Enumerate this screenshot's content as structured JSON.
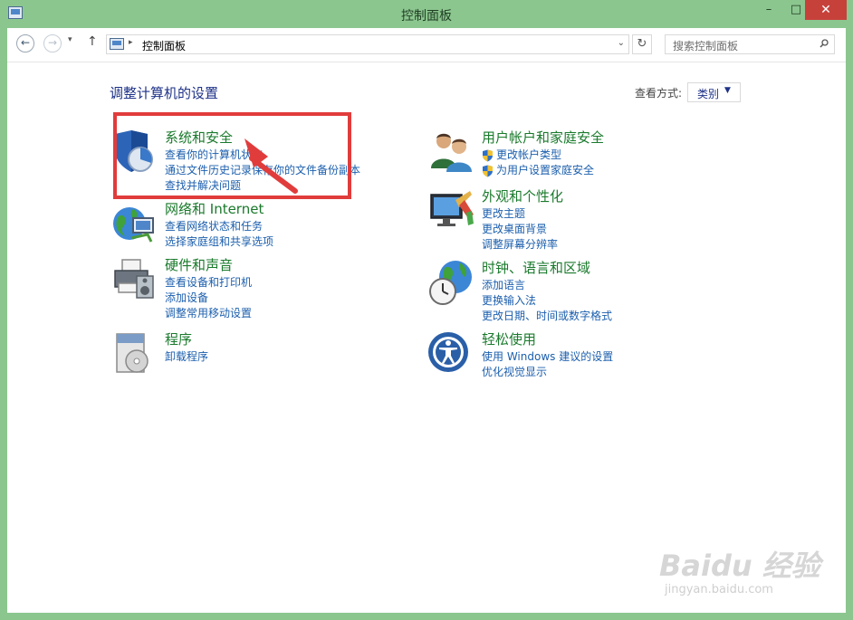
{
  "window": {
    "title": "控制面板",
    "controls": {
      "minimize": "–",
      "maximize": "□",
      "close": "✕"
    }
  },
  "address_bar": {
    "back": "←",
    "forward": "→",
    "dropdown": "▾",
    "up": "↑",
    "separator": "▸",
    "path": "控制面板",
    "path_dropdown": "⌄",
    "refresh": "↻",
    "search_placeholder": "搜索控制面板"
  },
  "main": {
    "heading": "调整计算机的设置",
    "view_by": {
      "label": "查看方式:",
      "value": "类别",
      "arrow": "▼"
    }
  },
  "categories": [
    {
      "icon": "shield-icon",
      "title": "系统和安全",
      "links": [
        "查看你的计算机状态",
        "通过文件历史记录保存你的文件备份副本",
        "查找并解决问题"
      ]
    },
    {
      "icon": "network-icon",
      "title": "网络和 Internet",
      "links": [
        "查看网络状态和任务",
        "选择家庭组和共享选项"
      ]
    },
    {
      "icon": "printer-icon",
      "title": "硬件和声音",
      "links": [
        "查看设备和打印机",
        "添加设备",
        "调整常用移动设置"
      ]
    },
    {
      "icon": "programs-icon",
      "title": "程序",
      "links": [
        "卸载程序"
      ]
    },
    {
      "icon": "users-icon",
      "title": "用户帐户和家庭安全",
      "links": [
        "更改帐户类型",
        "为用户设置家庭安全"
      ]
    },
    {
      "icon": "appearance-icon",
      "title": "外观和个性化",
      "links": [
        "更改主题",
        "更改桌面背景",
        "调整屏幕分辨率"
      ]
    },
    {
      "icon": "globe-clock-icon",
      "title": "时钟、语言和区域",
      "links": [
        "添加语言",
        "更换输入法",
        "更改日期、时间或数字格式"
      ]
    },
    {
      "icon": "ease-of-access-icon",
      "title": "轻松使用",
      "links": [
        "使用 Windows 建议的设置",
        "优化视觉显示"
      ]
    }
  ],
  "watermark": {
    "logo": "Baidu 经验",
    "url": "jingyan.baidu.com"
  },
  "colors": {
    "frame": "#8cc68f",
    "close": "#c7413b",
    "category_title": "#1a7a2c",
    "link": "#1c5fad",
    "annotation": "#e13c3c"
  }
}
